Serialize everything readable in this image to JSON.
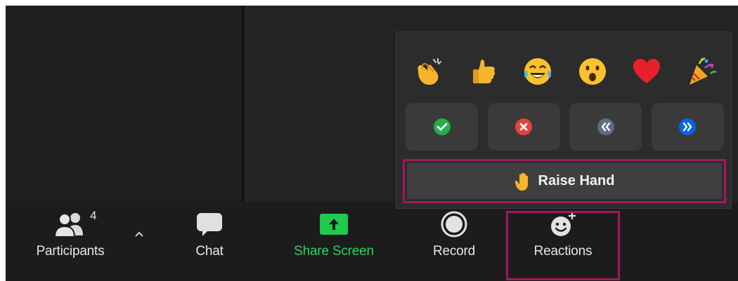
{
  "toolbar": {
    "participants_label": "Participants",
    "participants_count": "4",
    "chat_label": "Chat",
    "share_label": "Share Screen",
    "record_label": "Record",
    "reactions_label": "Reactions"
  },
  "reactions_popup": {
    "emojis": [
      "clapping-hands",
      "thumbs-up",
      "tears-of-joy",
      "open-mouth",
      "red-heart",
      "party-popper"
    ],
    "nonverbal": [
      "yes",
      "no",
      "slow-down",
      "speed-up"
    ],
    "raise_hand_label": "Raise Hand"
  },
  "colors": {
    "highlight": "#a3175e",
    "share_green": "#1fcb4f",
    "yes_green": "#23b04a",
    "no_red": "#e0443b",
    "slow_gray": "#5f6b82",
    "fast_blue": "#0b63e6"
  }
}
